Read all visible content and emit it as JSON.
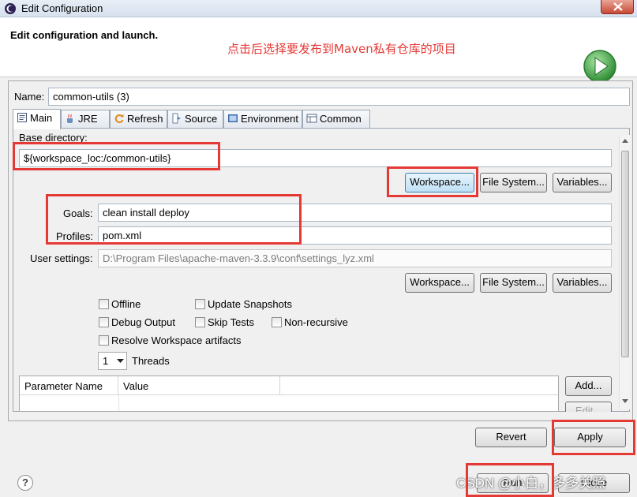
{
  "window": {
    "title": "Edit Configuration"
  },
  "header": {
    "title": "Edit configuration and launch.",
    "annotation": "点击后选择要发布到Maven私有仓库的项目"
  },
  "name_field": {
    "label": "Name:",
    "value": "common-utils (3)"
  },
  "tabs": [
    {
      "label": "Main",
      "icon": "main-tab-icon"
    },
    {
      "label": "JRE",
      "icon": "jre-tab-icon"
    },
    {
      "label": "Refresh",
      "icon": "refresh-tab-icon"
    },
    {
      "label": "Source",
      "icon": "source-tab-icon"
    },
    {
      "label": "Environment",
      "icon": "environment-tab-icon"
    },
    {
      "label": "Common",
      "icon": "common-tab-icon"
    }
  ],
  "main": {
    "base_dir_label": "Base directory:",
    "base_dir_value": "${workspace_loc:/common-utils}",
    "buttons": {
      "workspace": "Workspace...",
      "filesystem": "File System...",
      "variables": "Variables..."
    },
    "goals_label": "Goals:",
    "goals_value": "clean install deploy",
    "profiles_label": "Profiles:",
    "profiles_value": "pom.xml",
    "user_settings_label": "User settings:",
    "user_settings_value": "D:\\Program Files\\apache-maven-3.3.9\\conf\\settings_lyz.xml",
    "checkboxes": {
      "offline": "Offline",
      "update_snapshots": "Update Snapshots",
      "debug_output": "Debug Output",
      "skip_tests": "Skip Tests",
      "non_recursive": "Non-recursive",
      "resolve_workspace": "Resolve Workspace artifacts"
    },
    "threads_value": "1",
    "threads_label": "Threads",
    "table": {
      "col1": "Parameter Name",
      "col2": "Value"
    },
    "add_button": "Add...",
    "edit_button": "Edit..."
  },
  "footer": {
    "revert": "Revert",
    "apply": "Apply",
    "run": "Run",
    "close": "Close",
    "help": "?",
    "watermark": "CSDN @小白，多多关照"
  },
  "colors": {
    "annotation": "#e53935",
    "launch": "#43a047"
  }
}
